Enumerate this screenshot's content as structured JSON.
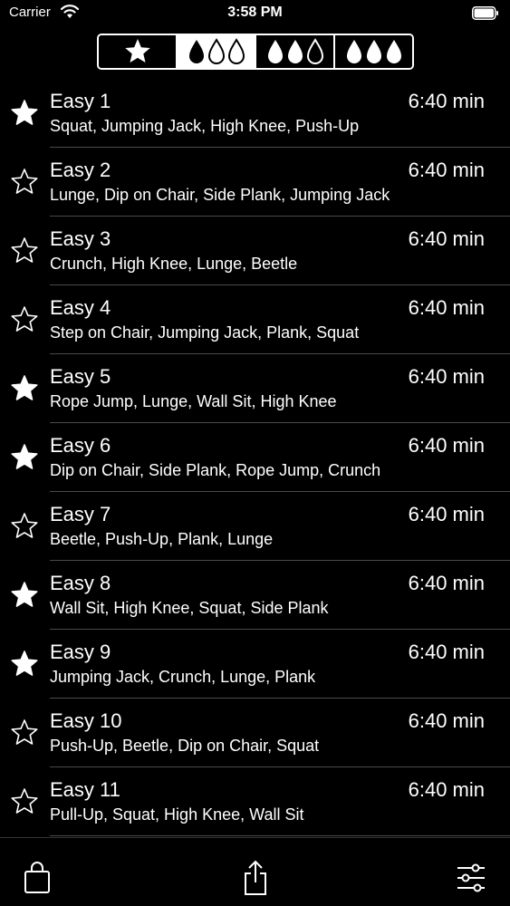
{
  "status": {
    "carrier": "Carrier",
    "time": "3:58 PM"
  },
  "segments": [
    {
      "icon": "star-icon",
      "active": false
    },
    {
      "icon": "one-drop-icon",
      "active": true
    },
    {
      "icon": "two-drop-icon",
      "active": false
    },
    {
      "icon": "three-drop-icon",
      "active": false
    }
  ],
  "workouts": [
    {
      "title": "Easy 1",
      "duration": "6:40 min",
      "exercises": "Squat, Jumping Jack, High Knee, Push-Up",
      "favorite": true
    },
    {
      "title": "Easy 2",
      "duration": "6:40 min",
      "exercises": "Lunge, Dip on Chair, Side Plank, Jumping Jack",
      "favorite": false
    },
    {
      "title": "Easy 3",
      "duration": "6:40 min",
      "exercises": "Crunch, High Knee, Lunge, Beetle",
      "favorite": false
    },
    {
      "title": "Easy 4",
      "duration": "6:40 min",
      "exercises": "Step on Chair, Jumping Jack, Plank, Squat",
      "favorite": false
    },
    {
      "title": "Easy 5",
      "duration": "6:40 min",
      "exercises": "Rope Jump, Lunge, Wall Sit, High Knee",
      "favorite": true
    },
    {
      "title": "Easy 6",
      "duration": "6:40 min",
      "exercises": "Dip on Chair, Side Plank, Rope Jump, Crunch",
      "favorite": true
    },
    {
      "title": "Easy 7",
      "duration": "6:40 min",
      "exercises": "Beetle, Push-Up, Plank, Lunge",
      "favorite": false
    },
    {
      "title": "Easy 8",
      "duration": "6:40 min",
      "exercises": "Wall Sit, High Knee, Squat, Side Plank",
      "favorite": true
    },
    {
      "title": "Easy 9",
      "duration": "6:40 min",
      "exercises": "Jumping Jack, Crunch, Lunge, Plank",
      "favorite": true
    },
    {
      "title": "Easy 10",
      "duration": "6:40 min",
      "exercises": "Push-Up, Beetle, Dip on Chair, Squat",
      "favorite": false
    },
    {
      "title": "Easy 11",
      "duration": "6:40 min",
      "exercises": "Pull-Up, Squat, High Knee, Wall Sit",
      "favorite": false
    }
  ],
  "toolbar": [
    {
      "icon": "shopping-bag-icon"
    },
    {
      "icon": "share-icon"
    },
    {
      "icon": "settings-sliders-icon"
    }
  ]
}
